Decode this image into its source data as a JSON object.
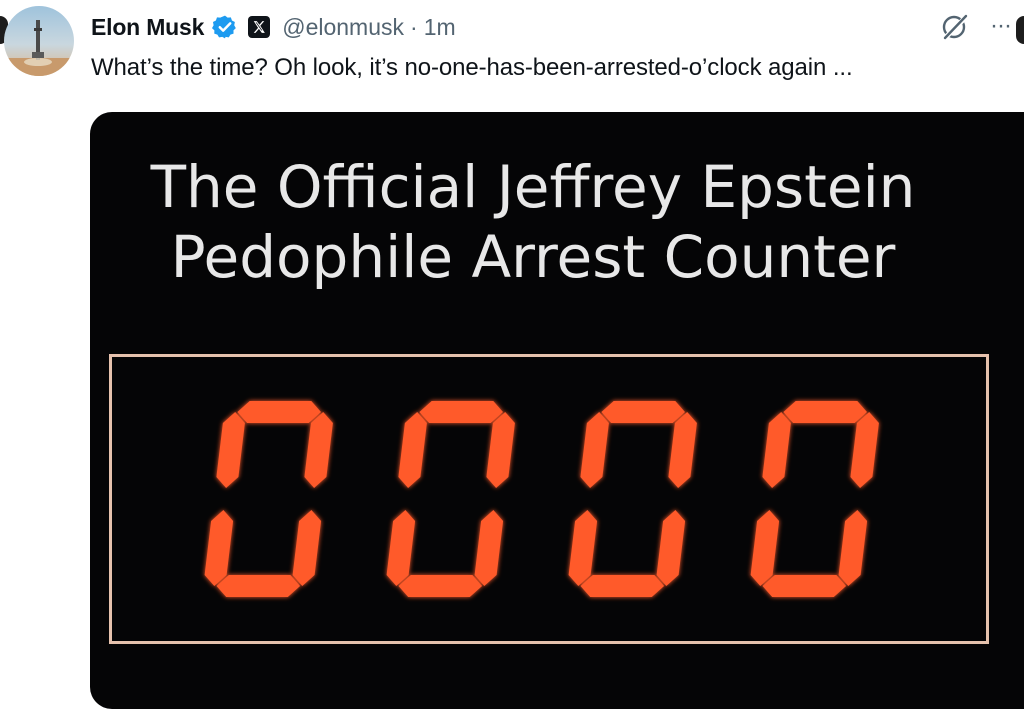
{
  "tweet": {
    "author_name": "Elon Musk",
    "handle": "@elonmusk",
    "separator": "·",
    "time": "1m",
    "text": "What’s the time? Oh look, it’s no-one-has-been-arrested-o’clock again ...",
    "more": "···"
  },
  "media": {
    "sign_title_line1": "The Official Jeffrey Epstein",
    "sign_title_line2": "Pedophile Arrest Counter",
    "counter_value": "0000",
    "digit_color": "#ff5a2a"
  },
  "icons": {
    "verified": "verified-badge-icon",
    "affiliate": "x-logo-icon",
    "grok": "grok-icon",
    "more": "more-options-icon",
    "avatar": "avatar"
  },
  "colors": {
    "verified_blue": "#1d9bf0",
    "text_primary": "#0f1419",
    "text_secondary": "#536471",
    "media_bg": "#050506",
    "counter_border": "#e6c2ad"
  }
}
